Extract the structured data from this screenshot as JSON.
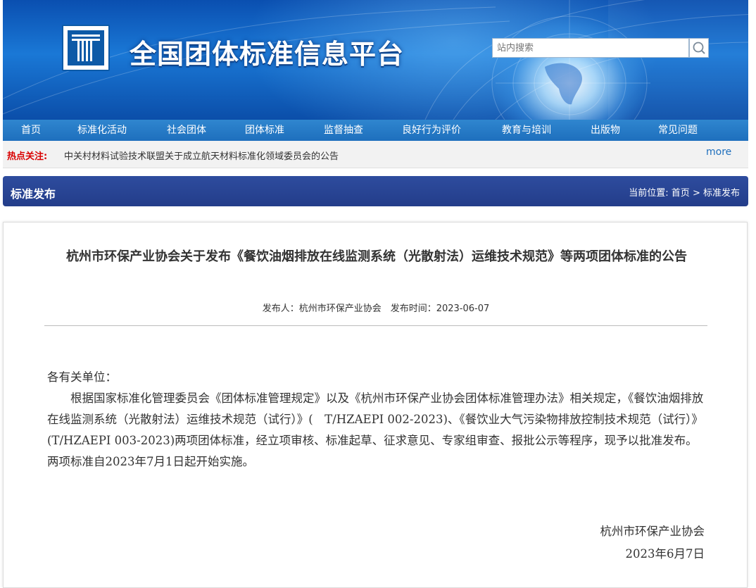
{
  "header": {
    "site_title": "全国团体标准信息平台",
    "search_placeholder": "站内搜索"
  },
  "nav": {
    "items": [
      "首页",
      "标准化活动",
      "社会团体",
      "团体标准",
      "监督抽查",
      "良好行为评价",
      "教育与培训",
      "出版物",
      "常见问题"
    ]
  },
  "hot": {
    "label": "热点关注:",
    "link": "中关村材料试验技术联盟关于成立航天材料标准化领域委员会的公告",
    "more": "more"
  },
  "section": {
    "title": "标准发布",
    "crumb_prefix": "当前位置:",
    "crumb_home": "首页",
    "crumb_sep": ">",
    "crumb_current": "标准发布"
  },
  "article": {
    "title": "杭州市环保产业协会关于发布《餐饮油烟排放在线监测系统（光散射法）运维技术规范》等两项团体标准的公告",
    "meta": "发布人：杭州市环保产业协会　发布时间：2023-06-07",
    "greeting": "各有关单位：",
    "body": "根据国家标准化管理委员会《团体标准管理规定》以及《杭州市环保产业协会团体标准管理办法》相关规定，《餐饮油烟排放在线监测系统（光散射法）运维技术规范（试行）》(　T/HZAEPI 002-2023)、《餐饮业大气污染物排放控制技术规范（试行）》(T/HZAEPI 003-2023)两项团体标准，经立项审核、标准起草、征求意见、专家组审查、报批公示等程序，现予以批准发布。两项标准自2023年7月1日起开始实施。",
    "signer": "杭州市环保产业协会",
    "date": "2023年6月7日"
  },
  "colors": {
    "nav_bg": "#1e6fbd",
    "section_bg": "#233d8a",
    "hot_label": "#d90000",
    "more_link": "#1e6fbd"
  }
}
